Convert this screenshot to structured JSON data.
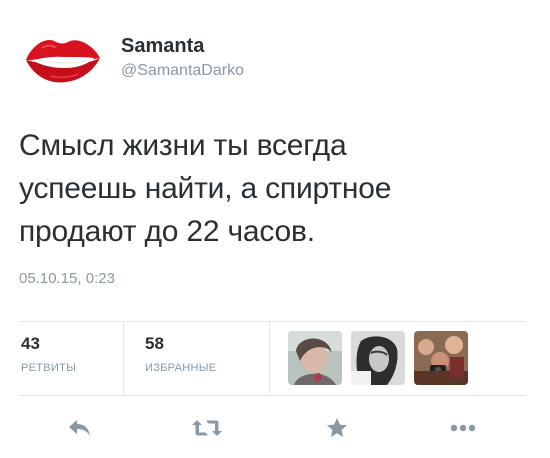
{
  "author": {
    "name": "Samanta",
    "handle": "@SamantaDarko",
    "avatar_icon": "red-lips-avatar"
  },
  "tweet": {
    "lines": [
      "Смысл жизни ты всегда",
      "успеешь найти, а спиртное",
      "продают до 22 часов."
    ],
    "timestamp": "05.10.15, 0:23"
  },
  "stats": {
    "retweets": {
      "count": "43",
      "label": "РЕТВИТЫ"
    },
    "favorites": {
      "count": "58",
      "label": "ИЗБРАННЫЕ"
    }
  },
  "favoriters": [
    "user-avatar-1",
    "user-avatar-2",
    "user-avatar-3"
  ],
  "actions": {
    "reply_icon": "reply-icon",
    "retweet_icon": "retweet-icon",
    "favorite_icon": "star-icon",
    "more_icon": "more-icon"
  },
  "colors": {
    "text": "#292f33",
    "meta": "#8899a6",
    "icon": "#8899a6",
    "divider": "#e1e8ed",
    "lips": "#d8121f"
  }
}
